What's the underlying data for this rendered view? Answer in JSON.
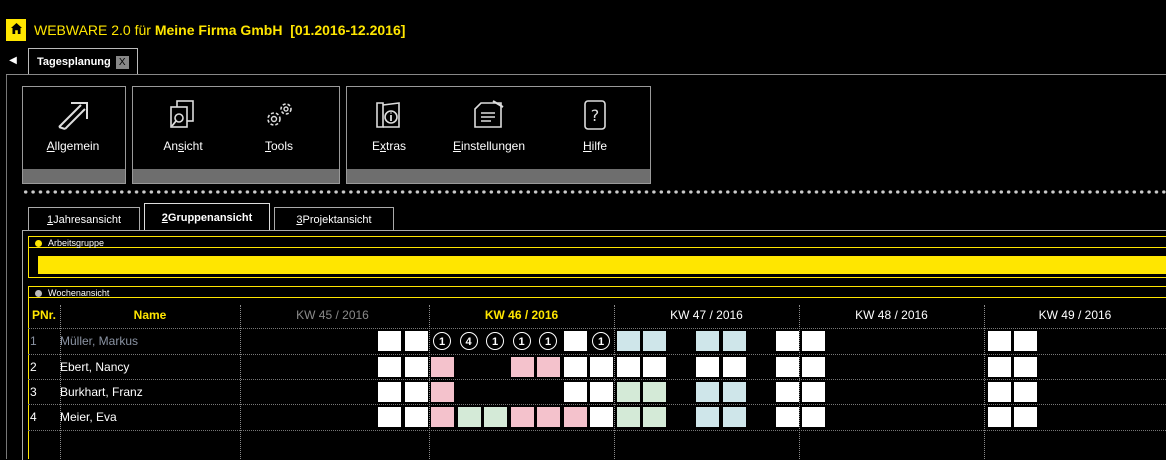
{
  "app": {
    "home_icon": "home-icon",
    "title_prefix": "WEBWARE 2.0 für ",
    "title_company": "Meine Firma GmbH",
    "title_period": "[01.2016-12.2016]"
  },
  "document_tab": {
    "label": "Tagesplanung",
    "close": "X"
  },
  "ribbon": {
    "groups": [
      {
        "buttons": [
          {
            "label_u": "A",
            "label_rest": "llgemein",
            "icon": "arrow-icon"
          }
        ]
      },
      {
        "buttons": [
          {
            "label_pre": "An",
            "label_u": "s",
            "label_rest": "icht",
            "icon": "documents-icon"
          },
          {
            "label_u": "T",
            "label_rest": "ools",
            "icon": "gears-icon"
          }
        ]
      },
      {
        "buttons": [
          {
            "label_pre": "E",
            "label_u": "x",
            "label_rest": "tras",
            "icon": "info-folder-icon"
          },
          {
            "label_u": "E",
            "label_rest": "instellungen",
            "icon": "settings-folder-icon"
          },
          {
            "label_u": "H",
            "label_rest": "ilfe",
            "icon": "help-icon"
          }
        ]
      }
    ]
  },
  "view_tabs": [
    {
      "num": "1",
      "label": " Jahresansicht",
      "active": false
    },
    {
      "num": "2",
      "label": " Gruppenansicht",
      "active": true
    },
    {
      "num": "3",
      "label": " Projektansicht",
      "active": false
    }
  ],
  "sections": {
    "group_label": "Arbeitsgruppe",
    "week_label": "Wochenansicht"
  },
  "colors": {
    "accent": "#ffe600",
    "white_cell": "#ffffff",
    "pink_cell": "#f4c2cc",
    "green_cell": "#d4ead7",
    "blue_cell": "#cfe6ea",
    "dim_text": "#8a93a3"
  },
  "grid": {
    "header_pnr": "PNr.",
    "header_name": "Name",
    "weeks": [
      {
        "label": "KW 45 / 2016",
        "style": "dim"
      },
      {
        "label": "KW 46 / 2016",
        "style": "current"
      },
      {
        "label": "KW 47 / 2016",
        "style": "normal"
      },
      {
        "label": "KW 48 / 2016",
        "style": "normal"
      },
      {
        "label": "KW 49 / 2016",
        "style": "normal"
      }
    ],
    "rows": [
      {
        "pnr": "1",
        "name": "Müller, Markus",
        "dim": true
      },
      {
        "pnr": "2",
        "name": "Ebert, Nancy",
        "dim": false
      },
      {
        "pnr": "3",
        "name": "Burkhart, Franz",
        "dim": false
      },
      {
        "pnr": "4",
        "name": "Meier, Eva",
        "dim": false
      }
    ],
    "row1_badges": [
      "1",
      "4",
      "1",
      "1",
      "1",
      "1"
    ],
    "day_states": [
      [
        "",
        "",
        "",
        "",
        "w",
        "w",
        "b",
        "b",
        "b",
        "b",
        "b",
        "w",
        "b",
        "bl",
        "bl",
        "",
        "bl",
        "bl",
        "",
        "w",
        "w",
        "",
        "",
        "",
        "",
        "",
        "",
        "w",
        "w",
        "",
        "",
        "",
        "",
        "",
        "w",
        "w"
      ],
      [
        "",
        "",
        "",
        "",
        "w",
        "w",
        "p",
        "",
        "",
        "p",
        "p",
        "w",
        "w",
        "w",
        "w",
        "",
        "w",
        "w",
        "",
        "w",
        "w",
        "",
        "",
        "",
        "",
        "",
        "",
        "w",
        "w",
        "",
        "",
        "",
        "",
        "",
        "w",
        "w"
      ],
      [
        "",
        "",
        "",
        "",
        "w",
        "w",
        "p",
        "",
        "",
        "",
        "",
        "w",
        "w",
        "g",
        "g",
        "",
        "bl",
        "bl",
        "",
        "w",
        "w",
        "",
        "",
        "",
        "",
        "",
        "",
        "w",
        "w",
        "",
        "",
        "",
        "",
        "",
        "w",
        "w"
      ],
      [
        "",
        "",
        "",
        "",
        "w",
        "w",
        "p",
        "g",
        "g",
        "p",
        "p",
        "p",
        "w",
        "g",
        "g",
        "",
        "bl",
        "bl",
        "",
        "w",
        "w",
        "",
        "",
        "",
        "",
        "",
        "",
        "w",
        "w",
        "",
        "",
        "",
        "",
        "",
        "w",
        "w"
      ]
    ]
  }
}
